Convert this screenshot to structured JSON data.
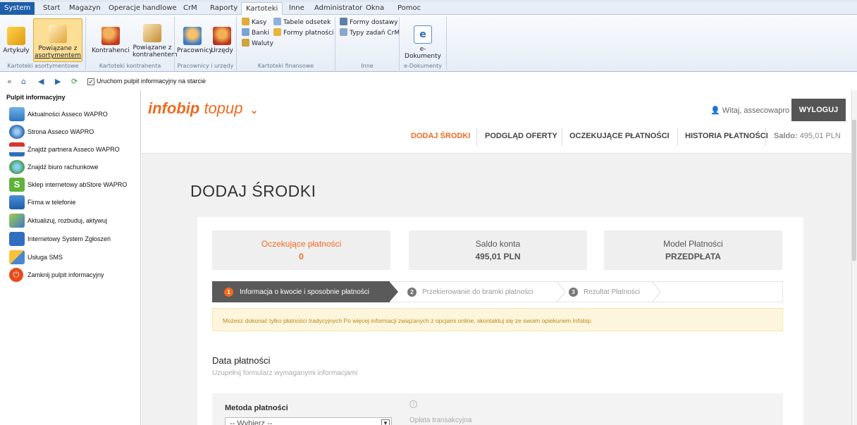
{
  "menu": {
    "tabs": [
      "System",
      "Start",
      "Magazyn",
      "Operacje handlowe",
      "CrM",
      "Raporty",
      "Kartoteki",
      "Inne",
      "Administrator",
      "Okna",
      "Pomoc"
    ],
    "active": "Kartoteki"
  },
  "ribbon": {
    "artykuly": "Artykuły",
    "powiazane_asort_1": "Powiązane z",
    "powiazane_asort_2": "asortymentem",
    "kontrahenci": "Kontrahenci",
    "powiazane_kontr_1": "Powiązane z",
    "powiazane_kontr_2": "kontrahentem",
    "pracownicy": "Pracownicy",
    "urzedy": "Urzędy",
    "kasy": "Kasy",
    "banki": "Banki",
    "waluty": "Waluty",
    "tabele_odsetek": "Tabele odsetek",
    "formy_platnosci": "Formy płatności",
    "formy_dostawy": "Formy dostawy",
    "typy_zadan": "Typy zadań CrM",
    "e_dokumenty": "e-Dokumenty",
    "groups": {
      "asort": "Kartoteki asortymentowe",
      "kontr": "Kartoteki kontrahenta",
      "prac": "Pracownicy i urzędy",
      "fin": "Kartoteki finansowe",
      "inne": "Inne",
      "edok": "e-Dokumenty"
    }
  },
  "navbar": {
    "checkbox_label": "Uruchom pulpit informacyjny na starcie",
    "checked": true
  },
  "sidebar": {
    "title": "Pulpit informacyjny",
    "items": [
      {
        "label": "Aktualności Asseco WAPRO",
        "icon": "news-icon"
      },
      {
        "label": "Strona Asseco WAPRO",
        "icon": "globe-icon"
      },
      {
        "label": "Znajdź partnera Asseco WAPRO",
        "icon": "partner-icon"
      },
      {
        "label": "Znajdź biuro rachunkowe",
        "icon": "office-icon"
      },
      {
        "label": "Sklep internetowy abStore WAPRO",
        "icon": "shop-bag-icon"
      },
      {
        "label": "Firma w telefonie",
        "icon": "phone-icon"
      },
      {
        "label": "Aktualizuj, rozbuduj, aktywuj",
        "icon": "update-icon"
      },
      {
        "label": "Internetowy System Zgłoszeń",
        "icon": "tickets-icon"
      },
      {
        "label": "Usługa SMS",
        "icon": "sms-icon"
      },
      {
        "label": "Zamknij pulpit informacyjny",
        "icon": "power-icon"
      }
    ]
  },
  "brand": {
    "logo_bold": "infobip",
    "logo_light": "topup",
    "accent": "#f06a1f"
  },
  "user": {
    "greeting": "Witaj, assecowapro",
    "logout": "WYLOGUJ"
  },
  "topnav": {
    "items": [
      "DODAJ ŚRODKI",
      "PODGLĄD OFERTY",
      "OCZEKUJĄCE PŁATNOŚCI",
      "HISTORIA PŁATNOŚCI"
    ],
    "saldo_label": "Saldo:",
    "saldo_value": "495,01 PLN"
  },
  "page": {
    "title": "DODAJ ŚRODKI"
  },
  "stats": [
    {
      "label": "Oczekujące płatności",
      "value": "0"
    },
    {
      "label": "Saldo konta",
      "value": "495,01 PLN"
    },
    {
      "label": "Model Płatności",
      "value": "PRZEDPŁATA"
    }
  ],
  "steps": [
    {
      "num": "1",
      "label": "Informacja o kwocie i sposobnie płatności"
    },
    {
      "num": "2",
      "label": "Przekierowanie do bramki płatności"
    },
    {
      "num": "3",
      "label": "Rezultat Płatności"
    }
  ],
  "notice": "Możesz dokonać tylko płatności tradycyjnych Po więcej informacji związanych z opcjami online, skontaktuj się ze swoim opiekunem Infobip.",
  "form": {
    "section_title": "Data płatności",
    "section_subtitle": "Uzupełnij formularz wymaganymi informacjami",
    "method_label": "Metoda płatności",
    "method_value": "-- Wybierz --",
    "info": "i",
    "fee_label": "Opłata transakcyjna"
  }
}
